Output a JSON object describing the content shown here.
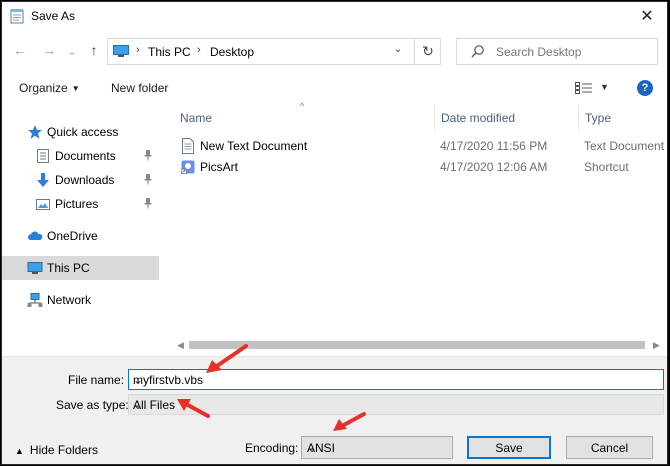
{
  "window": {
    "title": "Save As"
  },
  "address": {
    "segments": [
      "This PC",
      "Desktop"
    ]
  },
  "search": {
    "placeholder": "Search Desktop"
  },
  "toolbar": {
    "organize_label": "Organize",
    "new_folder_label": "New folder",
    "help_label": "?"
  },
  "sidebar": {
    "items": [
      {
        "label": "Quick access",
        "icon": "star-icon"
      },
      {
        "label": "Documents",
        "icon": "documents-icon",
        "pinned": true
      },
      {
        "label": "Downloads",
        "icon": "downloads-icon",
        "pinned": true
      },
      {
        "label": "Pictures",
        "icon": "pictures-icon",
        "pinned": true
      },
      {
        "label": "OneDrive",
        "icon": "cloud-icon"
      },
      {
        "label": "This PC",
        "icon": "computer-icon",
        "selected": true
      },
      {
        "label": "Network",
        "icon": "network-icon"
      }
    ]
  },
  "files": {
    "columns": [
      "Name",
      "Date modified",
      "Type"
    ],
    "rows": [
      {
        "name": "New Text Document",
        "date": "4/17/2020 11:56 PM",
        "type": "Text Document",
        "icon": "text-file-icon"
      },
      {
        "name": "PicsArt",
        "date": "4/17/2020 12:06 AM",
        "type": "Shortcut",
        "icon": "shortcut-icon"
      }
    ]
  },
  "form": {
    "file_name_label": "File name:",
    "file_name_value": "myfirstvb.vbs",
    "save_type_label": "Save as type:",
    "save_type_value": "All Files",
    "encoding_label": "Encoding:",
    "encoding_value": "ANSI"
  },
  "footer": {
    "hide_folders_label": "Hide Folders",
    "save_label": "Save",
    "cancel_label": "Cancel"
  },
  "colors": {
    "accent": "#0078d7",
    "annotation": "#e8302a",
    "selected_bg": "#d9d9d9"
  }
}
